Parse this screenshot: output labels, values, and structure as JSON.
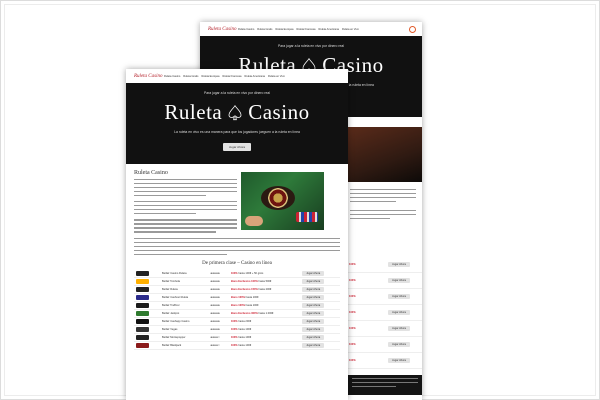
{
  "nav": {
    "logo": "Ruleta Casino",
    "links": [
      "Ruleta Casino",
      "Ruleta Gratis",
      "Ruleta Europea",
      "Ruleta Francesa",
      "Ruleta Americana",
      "Ruleta en Vivo"
    ]
  },
  "hero": {
    "top": "Para jugar a la ruleta en vivo por dinero real",
    "title_left": "Ruleta",
    "title_right": "Casino",
    "subtitle": "La ruleta en vivo es una manera para que los jugadores jueguen a la ruleta en línea",
    "button": "Jugar Ahora"
  },
  "content": {
    "section_title": "Ruleta Casino",
    "table_title": "De primera clase – Casino en línea"
  },
  "casino_table": [
    {
      "name": "Betfair Casino Ruleta",
      "rating": "★★★★★",
      "bonus": "100%",
      "bonus_text": "hasta 100€ + 50 giros",
      "cta": "Jugar Ahora",
      "color": "#222222"
    },
    {
      "name": "Betfair Tombola",
      "rating": "★★★★★",
      "bonus": "Bono Exclusivo 100%",
      "bonus_text": "hasta 500€",
      "cta": "Jugar Ahora",
      "color": "#ffb000"
    },
    {
      "name": "Betfair Ruleta",
      "rating": "★★★★★",
      "bonus": "Bono Exclusivo 150%",
      "bonus_text": "hasta 200€",
      "cta": "Jugar Ahora",
      "color": "#222222"
    },
    {
      "name": "Betfair Cashout Ruleta",
      "rating": "★★★★★",
      "bonus": "Bono 100%",
      "bonus_text": "hasta 100€",
      "cta": "Jugar Ahora",
      "color": "#2a2a8a"
    },
    {
      "name": "Betfair Trafficur",
      "rating": "★★★★★",
      "bonus": "Bono 100%",
      "bonus_text": "hasta 100€",
      "cta": "Jugar Ahora",
      "color": "#1a1a1a"
    },
    {
      "name": "Betfair Jackpot",
      "rating": "★★★★★",
      "bonus": "Bono Exclusivo 300%",
      "bonus_text": "hasta 1.000€",
      "cta": "Jugar Ahora",
      "color": "#2e7a2e"
    },
    {
      "name": "Betfair Cashapp Casino",
      "rating": "★★★★★",
      "bonus": "100%",
      "bonus_text": "hasta 200€",
      "cta": "Jugar Ahora",
      "color": "#111111"
    },
    {
      "name": "Betfair Vegas",
      "rating": "★★★★★",
      "bonus": "100%",
      "bonus_text": "hasta 100€",
      "cta": "Jugar Ahora",
      "color": "#333333"
    },
    {
      "name": "Betfair Montepopper",
      "rating": "★★★★☆",
      "bonus": "100%",
      "bonus_text": "hasta 100€",
      "cta": "Jugar Ahora",
      "color": "#222222"
    },
    {
      "name": "Betfair Blackjack",
      "rating": "★★★★☆",
      "bonus": "100%",
      "bonus_text": "hasta 100€",
      "cta": "Jugar Ahora",
      "color": "#8a1a1a"
    }
  ],
  "back_rows": [
    {
      "num": "100%",
      "cta": "Jugar Ahora"
    },
    {
      "num": "100%",
      "cta": "Jugar Ahora"
    },
    {
      "num": "100%",
      "cta": "Jugar Ahora"
    },
    {
      "num": "100%",
      "cta": "Jugar Ahora"
    },
    {
      "num": "100%",
      "cta": "Jugar Ahora"
    },
    {
      "num": "100%",
      "cta": "Jugar Ahora"
    },
    {
      "num": "100%",
      "cta": "Jugar Ahora"
    },
    {
      "num": "100%",
      "cta": "Jugar Ahora"
    }
  ]
}
